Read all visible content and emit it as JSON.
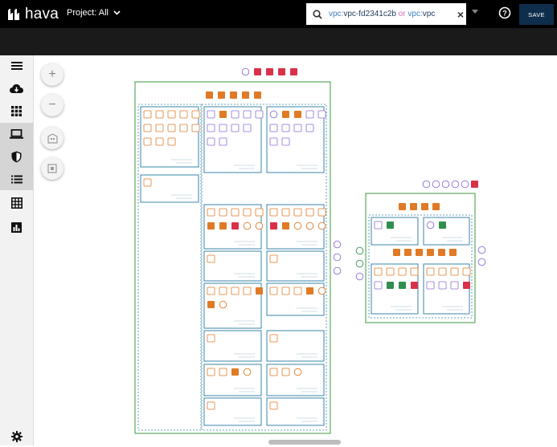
{
  "app": {
    "logo_text": "hava",
    "project_label": "Project: All",
    "save_label": "SAVE",
    "accent_color": "#0f2d4d"
  },
  "search": {
    "key1": "vpc:",
    "val1": "vpc-fd2341c2b",
    "or_text": " or ",
    "key2": "vpc:",
    "val2": "vpc"
  },
  "sidebar": {
    "items": [
      {
        "name": "menu-icon"
      },
      {
        "name": "cloud-download-icon"
      },
      {
        "name": "grid-icon"
      },
      {
        "name": "laptop-icon",
        "active": true
      },
      {
        "name": "shield-icon",
        "active": true
      },
      {
        "name": "list-icon",
        "active": true
      },
      {
        "name": "table-icon"
      },
      {
        "name": "bar-chart-icon"
      },
      {
        "name": "gear-icon"
      }
    ]
  },
  "zoom": {
    "zoom_in": "+",
    "zoom_out": "−"
  }
}
